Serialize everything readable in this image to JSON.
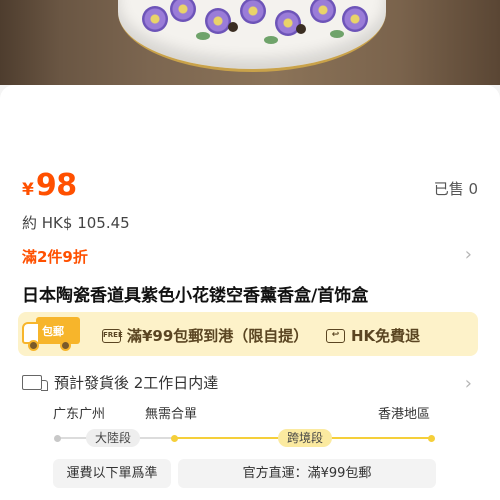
{
  "product": {
    "currency_symbol": "¥",
    "price": "98",
    "sold_label": "已售 0",
    "approx_price": "約 HK$ 105.45",
    "promo_label": "滿2件9折",
    "title": "日本陶瓷香道具紫色小花镂空香薰香盒/首饰盒"
  },
  "shipping_banner": {
    "truck_badge": "包郵",
    "free_shipping_icon": "FREE",
    "free_shipping": "滿¥99包郵到港（限自提）",
    "free_return_icon": "↩",
    "free_return": "HK免費退"
  },
  "delivery": {
    "estimate": "預計發貨後 2工作日内達",
    "from": "广东广州",
    "customs": "無需合單",
    "to": "香港地區",
    "segment_mainland": "大陸段",
    "segment_cross": "跨境段",
    "note_mainland": "運費以下單爲準",
    "note_cross": "官方直運：滿¥99包郵"
  },
  "icons": {
    "chevron": "chevron-right-icon",
    "truck": "delivery-truck-icon",
    "shipping": "shipping-truck-icon"
  },
  "colors": {
    "accent": "#ff5000",
    "banner_bg": "#fdf2c9",
    "route_gold": "#f5cf3a"
  }
}
